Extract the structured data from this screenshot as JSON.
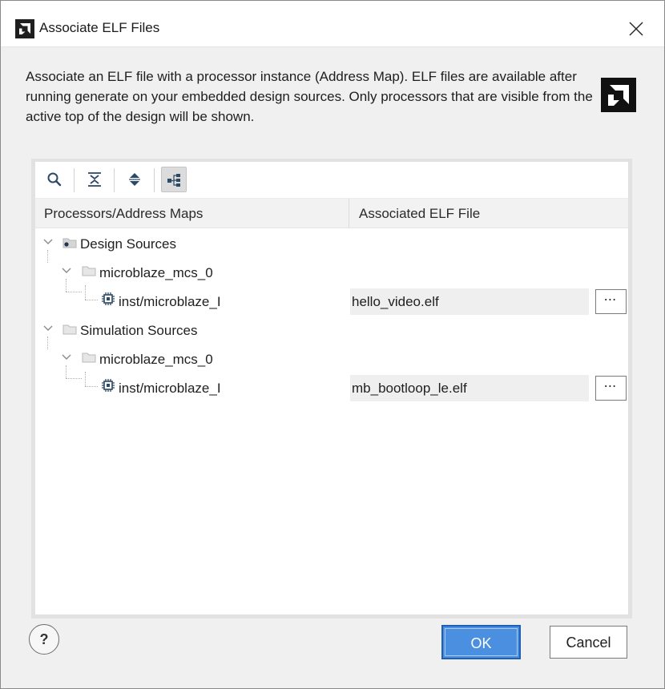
{
  "window": {
    "title": "Associate ELF Files",
    "app_icon": "amd-logo-icon",
    "close_icon": "close-icon"
  },
  "description": "Associate an ELF file with a processor instance (Address Map). ELF files are available after running generate on your embedded design sources. Only processors that are visible from the active top of the design will be shown.",
  "brand_logo": "amd-logo-icon",
  "toolbar": {
    "buttons": [
      {
        "icon": "search-icon"
      },
      {
        "icon": "collapse-all-icon"
      },
      {
        "icon": "expand-all-icon"
      },
      {
        "icon": "hierarchy-icon",
        "active": true
      }
    ]
  },
  "table": {
    "columns": [
      "Processors/Address Maps",
      "Associated ELF File"
    ],
    "groups": [
      {
        "label": "Design Sources",
        "instance": "microblaze_mcs_0",
        "processor": "inst/microblaze_I",
        "elf": "hello_video.elf",
        "browse_label": "⋯"
      },
      {
        "label": "Simulation Sources",
        "instance": "microblaze_mcs_0",
        "processor": "inst/microblaze_I",
        "elf": "mb_bootloop_le.elf",
        "browse_label": "⋯"
      }
    ]
  },
  "footer": {
    "help_label": "?",
    "ok_label": "OK",
    "cancel_label": "Cancel"
  },
  "colors": {
    "accent": "#4a8fe0",
    "accent_border": "#1f5fb5"
  }
}
